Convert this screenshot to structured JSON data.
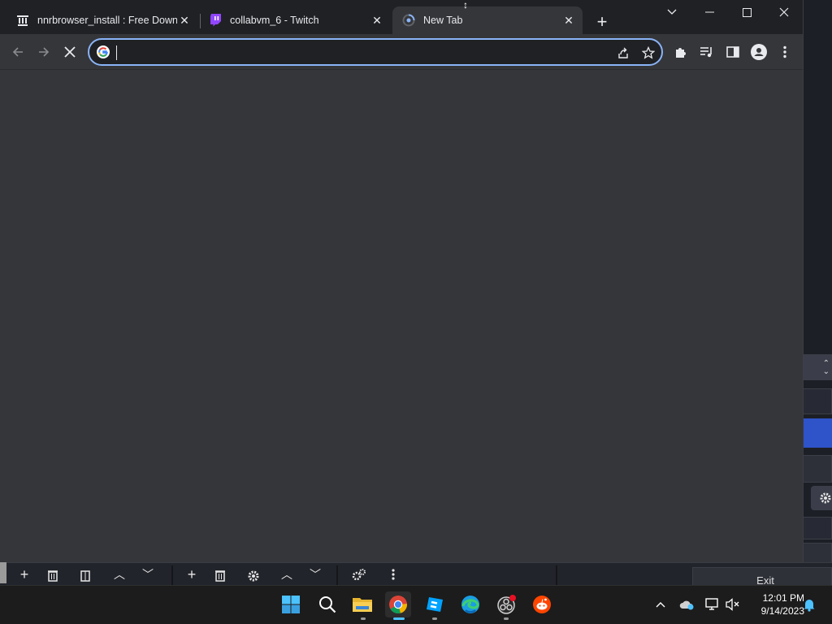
{
  "browser": {
    "tabs": [
      {
        "title": "nnrbrowser_install : Free Downlo",
        "icon": "archive-icon",
        "active": false
      },
      {
        "title": "collabvm_6 - Twitch",
        "icon": "twitch-icon",
        "active": false
      },
      {
        "title": "New Tab",
        "icon": "chrome-loading-icon",
        "active": true
      }
    ],
    "omnibox": {
      "value": "",
      "placeholder": ""
    },
    "accent_color": "#8ab4f8"
  },
  "background_app": {
    "exit_label": "Exit"
  },
  "taskbar": {
    "apps": [
      {
        "name": "Start",
        "icon": "windows-start-icon"
      },
      {
        "name": "Search",
        "icon": "search-icon"
      },
      {
        "name": "File Explorer",
        "icon": "folder-icon"
      },
      {
        "name": "Google Chrome",
        "icon": "chrome-icon"
      },
      {
        "name": "Roblox Studio",
        "icon": "roblox-studio-icon"
      },
      {
        "name": "Microsoft Edge",
        "icon": "edge-icon"
      },
      {
        "name": "OBS Studio",
        "icon": "obs-icon"
      },
      {
        "name": "Reddit",
        "icon": "reddit-icon"
      }
    ],
    "clock": {
      "time": "12:01 PM",
      "date": "9/14/2023"
    }
  }
}
